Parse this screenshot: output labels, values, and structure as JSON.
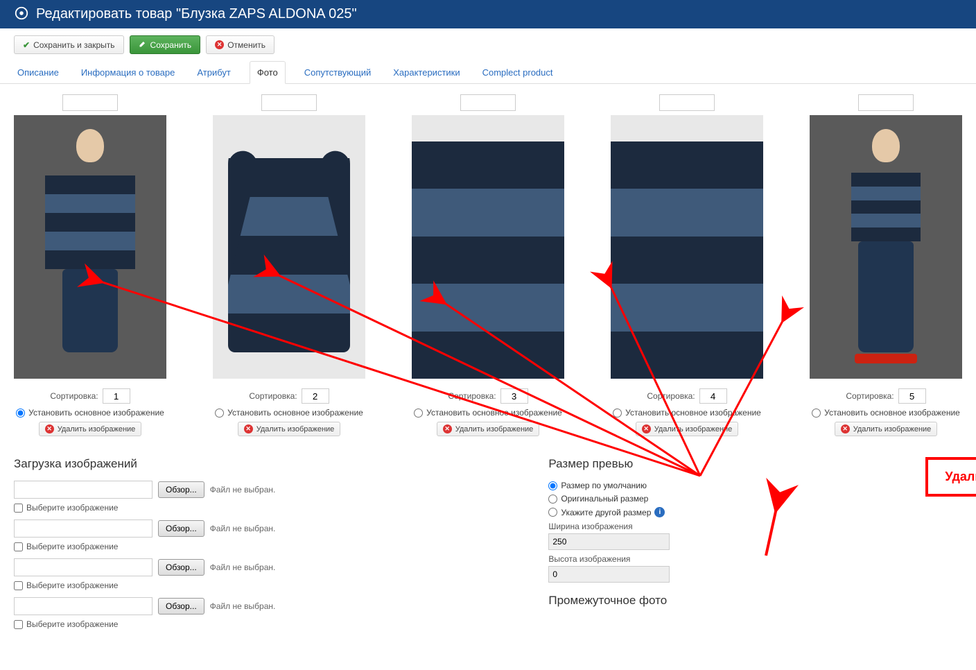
{
  "header": {
    "title": "Редактировать товар \"Блузка ZAPS ALDONA 025\""
  },
  "toolbar": {
    "save_close": "Сохранить и закрыть",
    "save": "Сохранить",
    "cancel": "Отменить"
  },
  "tabs": {
    "description": "Описание",
    "product_info": "Информация о товаре",
    "attribute": "Атрибут",
    "photo": "Фото",
    "related": "Сопутствующий",
    "characteristics": "Характеристики",
    "complect": "Complect product"
  },
  "photos": [
    {
      "sort": "1",
      "sort_label": "Сортировка:",
      "main_label": "Установить основное изображение",
      "delete_label": "Удалить изображение"
    },
    {
      "sort": "2",
      "sort_label": "Сортировка:",
      "main_label": "Установить основное изображение",
      "delete_label": "Удалить изображение"
    },
    {
      "sort": "3",
      "sort_label": "Сортировка:",
      "main_label": "Установить основное изображение",
      "delete_label": "Удалить изображение"
    },
    {
      "sort": "4",
      "sort_label": "Сортировка:",
      "main_label": "Установить основное изображение",
      "delete_label": "Удалить изображение"
    },
    {
      "sort": "5",
      "sort_label": "Сортировка:",
      "main_label": "Установить основное изображение",
      "delete_label": "Удалить изображение"
    }
  ],
  "upload": {
    "heading": "Загрузка изображений",
    "browse": "Обзор...",
    "no_file": "Файл не выбран.",
    "chk_label": "Выберите изображение"
  },
  "preview": {
    "heading": "Размер превью",
    "default_size": "Размер по умолчанию",
    "original_size": "Оригинальный размер",
    "custom_size": "Укажите другой размер",
    "width_label": "Ширина изображения",
    "width_value": "250",
    "height_label": "Высота изображения",
    "height_value": "0",
    "intermediate_heading": "Промежуточное фото"
  },
  "delete_all": "Удалить все фото товара"
}
